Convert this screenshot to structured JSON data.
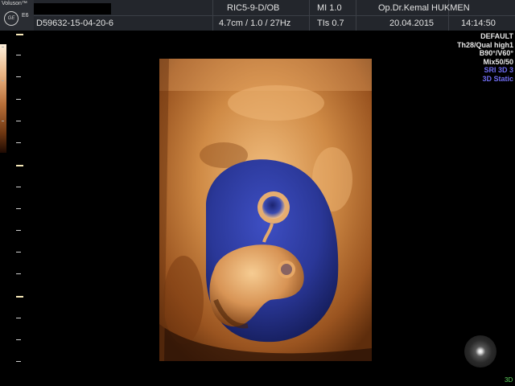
{
  "header": {
    "brand": "Voluson™",
    "logo_text": "GE",
    "model": "E6",
    "patient_id": "D59632-15-04-20-6",
    "probe": "RIC5-9-D/OB",
    "mi": "MI  1.0",
    "operator": "Op.Dr.Kemal HUKMEN",
    "depth_freq": "4.7cm / 1.0 / 27Hz",
    "tis": "TIs  0.7",
    "date": "20.04.2015",
    "time": "14:14:50"
  },
  "settings": [
    {
      "text": "DEFAULT",
      "color": "#e8e8e8"
    },
    {
      "text": "Th28/Qual high1",
      "color": "#e8e8e8"
    },
    {
      "text": "B90°/V60°",
      "color": "#e8e8e8"
    },
    {
      "text": "Mix50/50",
      "color": "#e8e8e8"
    },
    {
      "text": "SRI 3D 3",
      "color": "#6f6cf0"
    },
    {
      "text": "3D Static",
      "color": "#6f6cf0"
    }
  ],
  "mode_tag": "3D",
  "colors": {
    "tissue": "#c07a3a",
    "fluid": "#2c3aa0",
    "background": "#000000"
  },
  "icons": [
    "ge-logo-icon",
    "orientation-marker-icon"
  ]
}
